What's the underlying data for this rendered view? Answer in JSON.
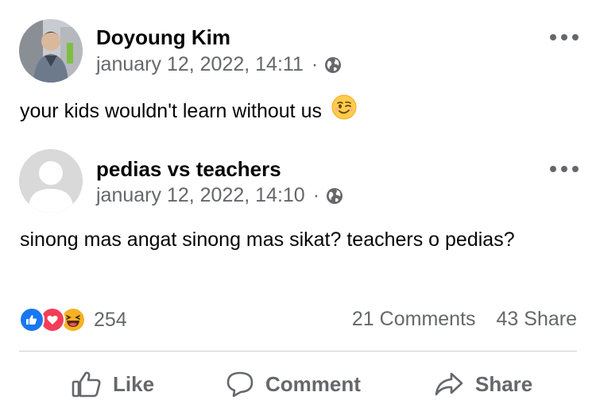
{
  "posts": [
    {
      "author": "Doyoung Kim",
      "timestamp": "january 12, 2022, 14:11",
      "separator": "·",
      "audience_icon": "globe-icon",
      "text": "your kids wouldn't learn without us",
      "emoji": "winking-face"
    },
    {
      "author": "pedias vs teachers",
      "timestamp": "january 12, 2022, 14:10",
      "separator": "·",
      "audience_icon": "globe-icon",
      "text": "sinong mas angat sinong mas sikat? teachers o pedias?"
    }
  ],
  "stats": {
    "reaction_types": [
      "like",
      "love",
      "haha"
    ],
    "reaction_count": "254",
    "comments": "21 Comments",
    "shares": "43 Share"
  },
  "actions": {
    "like_label": "Like",
    "comment_label": "Comment",
    "share_label": "Share"
  },
  "colors": {
    "secondary_text": "#65676b",
    "like_blue": "#1877f2",
    "love_red": "#f33e58",
    "haha_yellow": "#f7b125"
  }
}
